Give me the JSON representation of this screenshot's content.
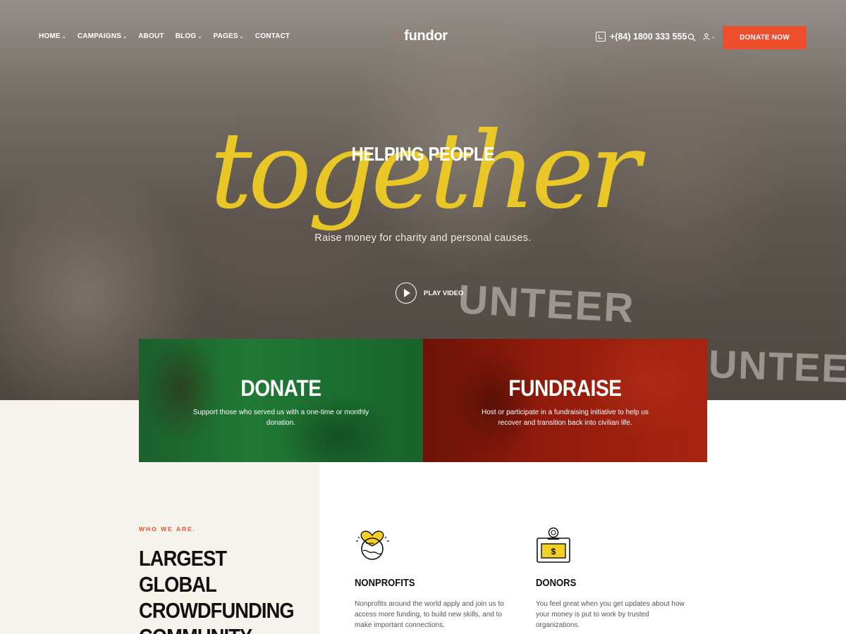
{
  "header": {
    "nav": [
      {
        "label": "HOME",
        "has_dropdown": true
      },
      {
        "label": "CAMPAIGNS",
        "has_dropdown": true
      },
      {
        "label": "ABOUT",
        "has_dropdown": false
      },
      {
        "label": "BLOG",
        "has_dropdown": true
      },
      {
        "label": "PAGES",
        "has_dropdown": true
      },
      {
        "label": "CONTACT",
        "has_dropdown": false
      }
    ],
    "logo": "fundor",
    "phone": "+(84) 1800 333 555",
    "donate_button": "DONATE NOW",
    "icons": {
      "phone": "phone-icon",
      "search": "search-icon",
      "user": "user-icon"
    }
  },
  "hero": {
    "pre_title": "HELPING PEOPLE",
    "script_title": "together",
    "subtitle": "Raise money for charity and personal causes.",
    "play_label": "PLAY VIDEO",
    "background_text": [
      "UNTEER",
      "UNTEER"
    ]
  },
  "cards": [
    {
      "title": "DONATE",
      "text": "Support those who served us with a one-time or monthly donation.",
      "color": "#258a3c"
    },
    {
      "title": "FUNDRAISE",
      "text": "Host or participate in a fundraising initiative to help us recover and transition back into civilian life.",
      "color": "#a8200e"
    }
  ],
  "about": {
    "label": "WHO WE ARE.",
    "title": "LARGEST GLOBAL CROWDFUNDING COMMUNITY"
  },
  "features": [
    {
      "icon": "heart-globe-icon",
      "title": "NONPROFITS",
      "text": "Nonprofits around the world apply and join us to access more funding, to build new skills, and to make important connections."
    },
    {
      "icon": "donation-box-icon",
      "title": "DONORS",
      "text": "You feel great when you get updates about how your money is put to work by trusted organizations."
    }
  ],
  "colors": {
    "accent": "#ef4e2c",
    "highlight": "#f3d023",
    "green": "#258a3c",
    "red": "#a8200e",
    "cream": "#f6f2ec"
  }
}
